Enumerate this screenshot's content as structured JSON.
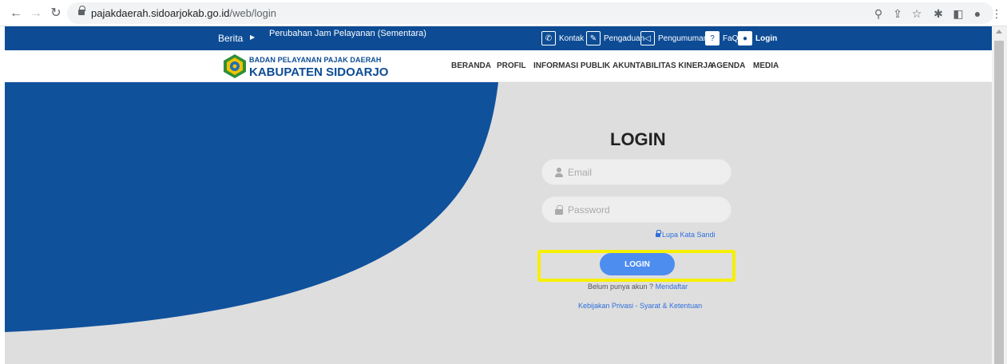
{
  "browser": {
    "url_domain": "pajakdaerah.sidoarjokab.go.id",
    "url_path": "/web/login"
  },
  "topbar": {
    "news_label": "Berita",
    "news_headline": "Perubahan Jam Pelayanan (Sementara)",
    "links": {
      "kontak": "Kontak",
      "pengaduan": "Pengaduan",
      "pengumuman": "Pengumuman",
      "faq": "FaQ",
      "login": "Login"
    }
  },
  "header": {
    "logo_line1": "BADAN PELAYANAN PAJAK DAERAH",
    "logo_line2": "KABUPATEN SIDOARJO",
    "menu": {
      "beranda": "BERANDA",
      "profil": "PROFIL",
      "informasi_publik": "INFORMASI PUBLIK",
      "akuntabilitas": "AKUNTABILITAS KINERJA",
      "agenda": "AGENDA",
      "media": "MEDIA"
    }
  },
  "login": {
    "title": "LOGIN",
    "email_placeholder": "Email",
    "password_placeholder": "Password",
    "forgot_label": "Lupa Kata Sandi",
    "button_label": "LOGIN",
    "signup_prompt": "Belum punya akun ?",
    "signup_link": "Mendaftar",
    "policy_link": "Kebijakan Privasi - Syarat & Ketentuan"
  },
  "colors": {
    "brand_blue": "#0d4c95",
    "button_blue": "#4d8df0",
    "highlight_yellow": "#f6f000"
  }
}
